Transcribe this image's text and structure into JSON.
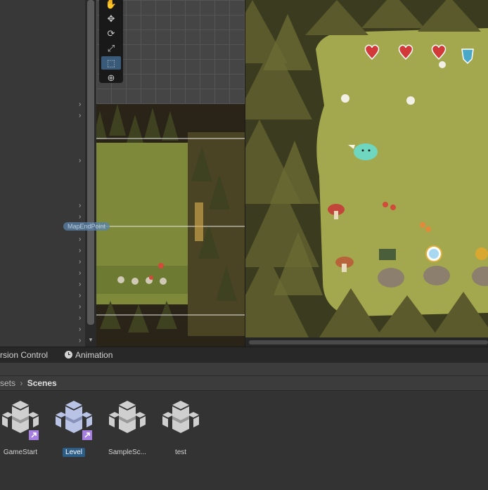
{
  "tabs": [
    {
      "label": "rsion Control"
    },
    {
      "label": "Animation"
    }
  ],
  "breadcrumb": {
    "parent": "sets",
    "separator": "›",
    "current": "Scenes"
  },
  "scene": {
    "marker_label": "MapEndPoint"
  },
  "assets": [
    {
      "label": "GameStart",
      "selected": false,
      "link_badge": true
    },
    {
      "label": "Level",
      "selected": true,
      "link_badge": true
    },
    {
      "label": "SampleSc...",
      "selected": false,
      "link_badge": false
    },
    {
      "label": "test",
      "selected": false,
      "link_badge": false
    }
  ],
  "icons": {
    "hierarchy_expand": "chevron-right-icon",
    "scroll_down": "triangle-down-icon",
    "animation_tab": "clock-icon",
    "tools": [
      "hand-tool-icon",
      "move-tool-icon",
      "rotate-tool-icon",
      "scale-tool-icon",
      "rect-tool-icon",
      "transform-tool-icon"
    ]
  },
  "colors": {
    "selection": "#2c5d87",
    "active_tool": "#3a5a7a",
    "link_badge": "#a77fe0"
  }
}
